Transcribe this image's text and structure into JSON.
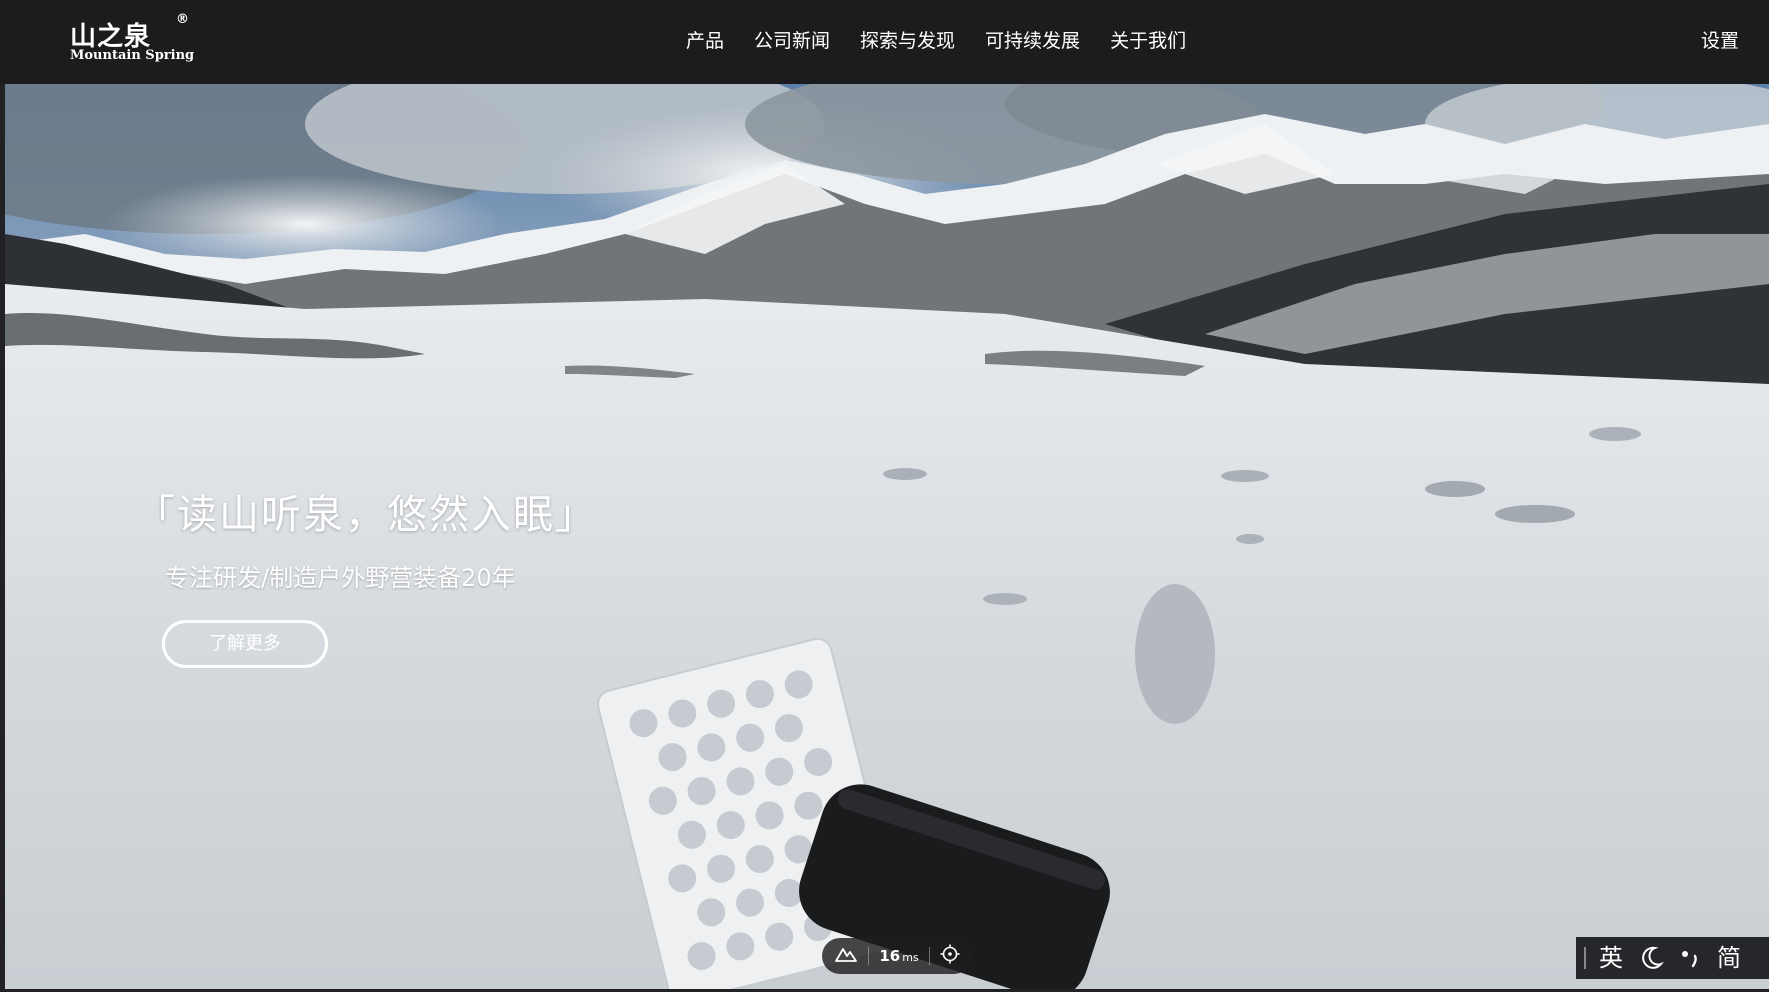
{
  "brand": {
    "name_cn": "山之泉",
    "name_en": "Mountain Spring",
    "registered": "®"
  },
  "nav": {
    "items": [
      "产品",
      "公司新闻",
      "探索与发现",
      "可持续发展",
      "关于我们"
    ],
    "settings": "设置"
  },
  "hero": {
    "title": "「读山听泉，悠然入眠」",
    "subtitle": "专注研发/制造户外野营装备20年",
    "cta_label": "了解更多"
  },
  "latency": {
    "value": "16",
    "unit": "ms"
  },
  "ime": {
    "mode": "英",
    "script": "简",
    "icons": [
      "moon-icon",
      "punctuation-icon"
    ]
  },
  "colors": {
    "header_bg": "#1c1c1e",
    "accent_text": "#ffffff"
  }
}
